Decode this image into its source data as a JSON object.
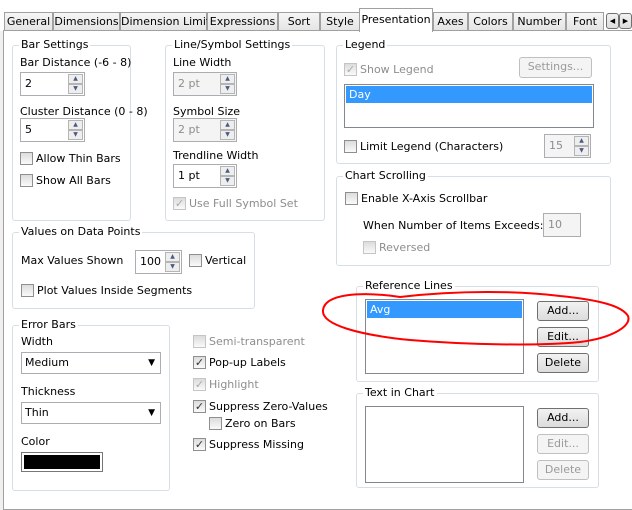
{
  "tabs": [
    "General",
    "Dimensions",
    "Dimension Limits",
    "Expressions",
    "Sort",
    "Style",
    "Presentation",
    "Axes",
    "Colors",
    "Number",
    "Font"
  ],
  "active_tab": "Presentation",
  "bar_settings": {
    "title": "Bar Settings",
    "bar_distance_label": "Bar Distance (-6 - 8)",
    "bar_distance": "2",
    "cluster_distance_label": "Cluster Distance (0 - 8)",
    "cluster_distance": "5",
    "allow_thin_bars": "Allow Thin Bars",
    "show_all_bars": "Show All Bars"
  },
  "line_symbol": {
    "title": "Line/Symbol Settings",
    "line_width_label": "Line Width",
    "line_width": "2 pt",
    "symbol_size_label": "Symbol Size",
    "symbol_size": "2 pt",
    "trendline_width_label": "Trendline Width",
    "trendline_width": "1 pt",
    "use_full_symbol_set": "Use Full Symbol Set"
  },
  "values_on_data_points": {
    "title": "Values on Data Points",
    "max_values_label": "Max Values Shown",
    "max_values": "100",
    "vertical": "Vertical",
    "plot_inside": "Plot Values Inside Segments"
  },
  "error_bars": {
    "title": "Error Bars",
    "width_label": "Width",
    "width": "Medium",
    "thickness_label": "Thickness",
    "thickness": "Thin",
    "color_label": "Color",
    "color": "#000000"
  },
  "options": {
    "semi_transparent": "Semi-transparent",
    "popup_labels": "Pop-up Labels",
    "highlight": "Highlight",
    "suppress_zero": "Suppress Zero-Values",
    "zero_on_bars": "Zero on Bars",
    "suppress_missing": "Suppress Missing"
  },
  "legend": {
    "title": "Legend",
    "show_legend": "Show Legend",
    "settings": "Settings...",
    "items": [
      "Day"
    ],
    "limit_legend": "Limit Legend (Characters)",
    "limit_value": "15"
  },
  "chart_scrolling": {
    "title": "Chart Scrolling",
    "enable": "Enable X-Axis Scrollbar",
    "when_exceeds": "When Number of Items Exceeds:",
    "exceeds_value": "10",
    "reversed": "Reversed"
  },
  "reference_lines": {
    "title": "Reference Lines",
    "items": [
      "Avg"
    ],
    "add": "Add...",
    "edit": "Edit...",
    "delete": "Delete"
  },
  "text_in_chart": {
    "title": "Text in Chart",
    "add": "Add...",
    "edit": "Edit...",
    "delete": "Delete"
  },
  "annotation_color": "#ff0000"
}
